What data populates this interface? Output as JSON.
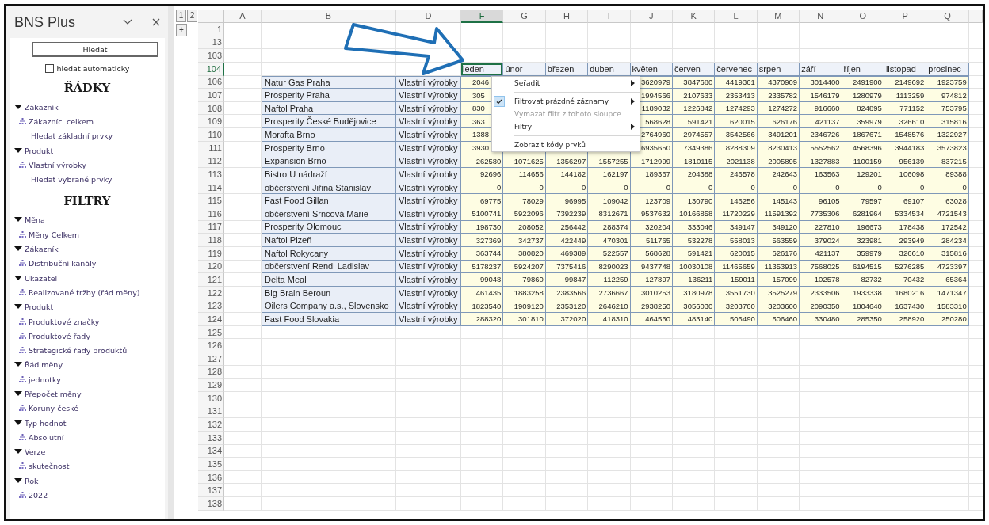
{
  "pane": {
    "title": "BNS Plus",
    "search_button": "Hledat",
    "auto_search": {
      "label": "hledat automaticky",
      "checked": false
    },
    "sections": [
      {
        "heading": "ŘÁDKY",
        "groups": [
          {
            "label": "Zákazník",
            "expanded": true,
            "children": [
              {
                "kind": "member",
                "label": "Zákazníci celkem"
              },
              {
                "kind": "link",
                "label": "Hledat základní prvky"
              }
            ]
          },
          {
            "label": "Produkt",
            "expanded": true,
            "children": [
              {
                "kind": "member",
                "label": "Vlastní výrobky"
              },
              {
                "kind": "link",
                "label": "Hledat vybrané prvky"
              }
            ]
          }
        ]
      },
      {
        "heading": "FILTRY",
        "groups": [
          {
            "label": "Měna",
            "expanded": true,
            "children": [
              {
                "kind": "member",
                "label": "Měny Celkem"
              }
            ]
          },
          {
            "label": "Zákazník",
            "expanded": true,
            "children": [
              {
                "kind": "member",
                "label": "Distribuční kanály"
              }
            ]
          },
          {
            "label": "Ukazatel",
            "expanded": true,
            "children": [
              {
                "kind": "member",
                "label": "Realizované tržby (řád měny)"
              }
            ]
          },
          {
            "label": "Produkt",
            "expanded": true,
            "children": [
              {
                "kind": "member",
                "label": "Produktové značky"
              },
              {
                "kind": "member",
                "label": "Produktové řady"
              },
              {
                "kind": "member",
                "label": "Strategické řady produktů"
              }
            ]
          },
          {
            "label": "Řád měny",
            "expanded": true,
            "children": [
              {
                "kind": "member",
                "label": "jednotky"
              }
            ]
          },
          {
            "label": "Přepočet měny",
            "expanded": true,
            "children": [
              {
                "kind": "member",
                "label": "Koruny české"
              }
            ]
          },
          {
            "label": "Typ hodnot",
            "expanded": true,
            "children": [
              {
                "kind": "member",
                "label": "Absolutní"
              }
            ]
          },
          {
            "label": "Verze",
            "expanded": true,
            "children": [
              {
                "kind": "member",
                "label": "skutečnost"
              }
            ]
          },
          {
            "label": "Rok",
            "expanded": true,
            "children": [
              {
                "kind": "member",
                "label": "2022"
              }
            ]
          }
        ]
      }
    ]
  },
  "sheet": {
    "outline": {
      "levels": [
        "1",
        "2"
      ],
      "expand": "+"
    },
    "columns": [
      {
        "letter": "A",
        "selected": false
      },
      {
        "letter": "B",
        "selected": false
      },
      {
        "letter": "D",
        "selected": false
      },
      {
        "letter": "F",
        "selected": true
      },
      {
        "letter": "G",
        "selected": false
      },
      {
        "letter": "H",
        "selected": false
      },
      {
        "letter": "I",
        "selected": false
      },
      {
        "letter": "J",
        "selected": false
      },
      {
        "letter": "K",
        "selected": false
      },
      {
        "letter": "L",
        "selected": false
      },
      {
        "letter": "M",
        "selected": false
      },
      {
        "letter": "N",
        "selected": false
      },
      {
        "letter": "O",
        "selected": false
      },
      {
        "letter": "P",
        "selected": false
      },
      {
        "letter": "Q",
        "selected": false
      }
    ],
    "rows": [
      {
        "number": "1",
        "kind": "blank",
        "selected": false
      },
      {
        "number": "13",
        "kind": "blank",
        "selected": false
      },
      {
        "number": "103",
        "kind": "blank",
        "selected": false
      },
      {
        "number": "104",
        "kind": "months",
        "selected": true,
        "months": [
          {
            "label": "leden",
            "selected": true
          },
          {
            "label": "únor",
            "selected": false
          },
          {
            "label": "březen",
            "selected": false
          },
          {
            "label": "duben",
            "selected": false
          },
          {
            "label": "květen",
            "selected": false
          },
          {
            "label": "červen",
            "selected": false
          },
          {
            "label": "červenec",
            "selected": false
          },
          {
            "label": "srpen",
            "selected": false
          },
          {
            "label": "září",
            "selected": false
          },
          {
            "label": "říjen",
            "selected": false
          },
          {
            "label": "listopad",
            "selected": false
          },
          {
            "label": "prosinec",
            "selected": false
          }
        ]
      },
      {
        "number": "106",
        "kind": "data",
        "selected": false,
        "under_menu": true,
        "customer": "Natur Gas Praha",
        "product": "Vlastní výrobky",
        "values": [
          "2046",
          "3620979",
          "3847680",
          "4419361",
          "4370909",
          "3014400",
          "2491900",
          "2149692",
          "1923759"
        ]
      },
      {
        "number": "107",
        "kind": "data",
        "selected": false,
        "under_menu": true,
        "customer": "Prosperity Praha",
        "product": "Vlastní výrobky",
        "values": [
          "305",
          "1994566",
          "2107633",
          "2353413",
          "2335782",
          "1546179",
          "1280979",
          "1113259",
          "974812"
        ]
      },
      {
        "number": "108",
        "kind": "data",
        "selected": false,
        "under_menu": true,
        "customer": "Naftol Praha",
        "product": "Vlastní výrobky",
        "values": [
          "830",
          "1189032",
          "1226842",
          "1274293",
          "1274272",
          "916660",
          "824895",
          "771152",
          "753795"
        ]
      },
      {
        "number": "109",
        "kind": "data",
        "selected": false,
        "under_menu": true,
        "customer": "Prosperity České Budějovice",
        "product": "Vlastní výrobky",
        "values": [
          "363",
          "568628",
          "591421",
          "620015",
          "626176",
          "421137",
          "359979",
          "326610",
          "315816"
        ]
      },
      {
        "number": "110",
        "kind": "data",
        "selected": false,
        "under_menu": true,
        "customer": "Morafta Brno",
        "product": "Vlastní výrobky",
        "values": [
          "1388",
          "2764960",
          "2974557",
          "3542566",
          "3491201",
          "2346726",
          "1867671",
          "1548576",
          "1322927"
        ]
      },
      {
        "number": "111",
        "kind": "data",
        "selected": false,
        "under_menu": true,
        "customer": "Prosperity Brno",
        "product": "Vlastní výrobky",
        "values": [
          "3930",
          "6935650",
          "7349386",
          "8288309",
          "8230413",
          "5552562",
          "4568396",
          "3944183",
          "3573823"
        ]
      },
      {
        "number": "112",
        "kind": "data",
        "selected": false,
        "customer": "Expansion Brno",
        "product": "Vlastní výrobky",
        "values": [
          "262580",
          "1071625",
          "1356297",
          "1557255",
          "1712999",
          "1810115",
          "2021138",
          "2005895",
          "1327883",
          "1100159",
          "956139",
          "837215"
        ]
      },
      {
        "number": "113",
        "kind": "data",
        "selected": false,
        "customer": "Bistro U nádraží",
        "product": "Vlastní výrobky",
        "values": [
          "92696",
          "114656",
          "144182",
          "162197",
          "189367",
          "204388",
          "246578",
          "242643",
          "163563",
          "129201",
          "106098",
          "89388"
        ]
      },
      {
        "number": "114",
        "kind": "data",
        "selected": false,
        "customer": "občerstvení Jiřina Stanislav",
        "product": "Vlastní výrobky",
        "values": [
          "0",
          "0",
          "0",
          "0",
          "0",
          "0",
          "0",
          "0",
          "0",
          "0",
          "0",
          "0"
        ]
      },
      {
        "number": "115",
        "kind": "data",
        "selected": false,
        "customer": "Fast Food Gillan",
        "product": "Vlastní výrobky",
        "values": [
          "69775",
          "78029",
          "96995",
          "109042",
          "123709",
          "130790",
          "146256",
          "145143",
          "96105",
          "79597",
          "69107",
          "63028"
        ]
      },
      {
        "number": "116",
        "kind": "data",
        "selected": false,
        "customer": "občerstvení Srncová Marie",
        "product": "Vlastní výrobky",
        "values": [
          "5100741",
          "5922096",
          "7392239",
          "8312671",
          "9537632",
          "10166858",
          "11720229",
          "11591392",
          "7735306",
          "6281964",
          "5334534",
          "4721543"
        ]
      },
      {
        "number": "117",
        "kind": "data",
        "selected": false,
        "customer": "Prosperity Olomouc",
        "product": "Vlastní výrobky",
        "values": [
          "198730",
          "208052",
          "256442",
          "288374",
          "320204",
          "333046",
          "349147",
          "349120",
          "227810",
          "196673",
          "178438",
          "172542"
        ]
      },
      {
        "number": "118",
        "kind": "data",
        "selected": false,
        "customer": "Naftol Plzeň",
        "product": "Vlastní výrobky",
        "values": [
          "327369",
          "342737",
          "422449",
          "470301",
          "511765",
          "532278",
          "558013",
          "563559",
          "379024",
          "323981",
          "293949",
          "284234"
        ]
      },
      {
        "number": "119",
        "kind": "data",
        "selected": false,
        "customer": "Naftol Rokycany",
        "product": "Vlastní výrobky",
        "values": [
          "363744",
          "380820",
          "469389",
          "522557",
          "568628",
          "591421",
          "620015",
          "626176",
          "421137",
          "359979",
          "326610",
          "315816"
        ]
      },
      {
        "number": "120",
        "kind": "data",
        "selected": false,
        "customer": "občerstvení Rendl Ladislav",
        "product": "Vlastní výrobky",
        "values": [
          "5178237",
          "5924207",
          "7375416",
          "8290023",
          "9437748",
          "10030108",
          "11465659",
          "11353913",
          "7568025",
          "6194515",
          "5276285",
          "4723397"
        ]
      },
      {
        "number": "121",
        "kind": "data",
        "selected": false,
        "customer": "Delta Meal",
        "product": "Vlastní výrobky",
        "values": [
          "99048",
          "79860",
          "99847",
          "112259",
          "127897",
          "136211",
          "159011",
          "157099",
          "102578",
          "82732",
          "70432",
          "65364"
        ]
      },
      {
        "number": "122",
        "kind": "data",
        "selected": false,
        "customer": "Big Brain Beroun",
        "product": "Vlastní výrobky",
        "values": [
          "461435",
          "1883258",
          "2383566",
          "2736667",
          "3010253",
          "3180978",
          "3551730",
          "3525279",
          "2333506",
          "1933338",
          "1680216",
          "1471347"
        ]
      },
      {
        "number": "123",
        "kind": "data",
        "selected": false,
        "customer": "Oilers Company a.s., Slovensko",
        "product": "Vlastní výrobky",
        "values": [
          "1823540",
          "1909120",
          "2353120",
          "2646210",
          "2938250",
          "3056030",
          "3203760",
          "3203600",
          "2090350",
          "1804640",
          "1637430",
          "1583310"
        ]
      },
      {
        "number": "124",
        "kind": "data",
        "selected": false,
        "customer": "Fast Food Slovakia",
        "product": "Vlastní výrobky",
        "values": [
          "288320",
          "301810",
          "372020",
          "418310",
          "464560",
          "483140",
          "506490",
          "506460",
          "330480",
          "285350",
          "258920",
          "250280"
        ]
      },
      {
        "number": "125",
        "kind": "blank",
        "selected": false
      },
      {
        "number": "126",
        "kind": "blank",
        "selected": false
      },
      {
        "number": "127",
        "kind": "blank",
        "selected": false
      },
      {
        "number": "128",
        "kind": "blank",
        "selected": false
      },
      {
        "number": "129",
        "kind": "blank",
        "selected": false
      },
      {
        "number": "130",
        "kind": "blank",
        "selected": false
      },
      {
        "number": "131",
        "kind": "blank",
        "selected": false
      },
      {
        "number": "132",
        "kind": "blank",
        "selected": false
      },
      {
        "number": "133",
        "kind": "blank",
        "selected": false
      },
      {
        "number": "134",
        "kind": "blank",
        "selected": false
      },
      {
        "number": "135",
        "kind": "blank",
        "selected": false
      },
      {
        "number": "136",
        "kind": "blank",
        "selected": false
      },
      {
        "number": "137",
        "kind": "blank",
        "selected": false
      },
      {
        "number": "138",
        "kind": "blank",
        "selected": false
      }
    ]
  },
  "context_menu": {
    "items": [
      {
        "kind": "item",
        "label": "Seřadit",
        "checked": false,
        "disabled": false,
        "submenu": true
      },
      {
        "kind": "separator"
      },
      {
        "kind": "item",
        "label": "Filtrovat prázdné záznamy",
        "checked": true,
        "disabled": false,
        "submenu": true
      },
      {
        "kind": "item",
        "label": "Vymazat filtr z tohoto sloupce",
        "checked": false,
        "disabled": true,
        "submenu": false
      },
      {
        "kind": "item",
        "label": "Filtry",
        "checked": false,
        "disabled": false,
        "submenu": true
      },
      {
        "kind": "separator"
      },
      {
        "kind": "item",
        "label": "Zobrazit kódy prvků",
        "checked": false,
        "disabled": false,
        "submenu": false
      }
    ]
  }
}
